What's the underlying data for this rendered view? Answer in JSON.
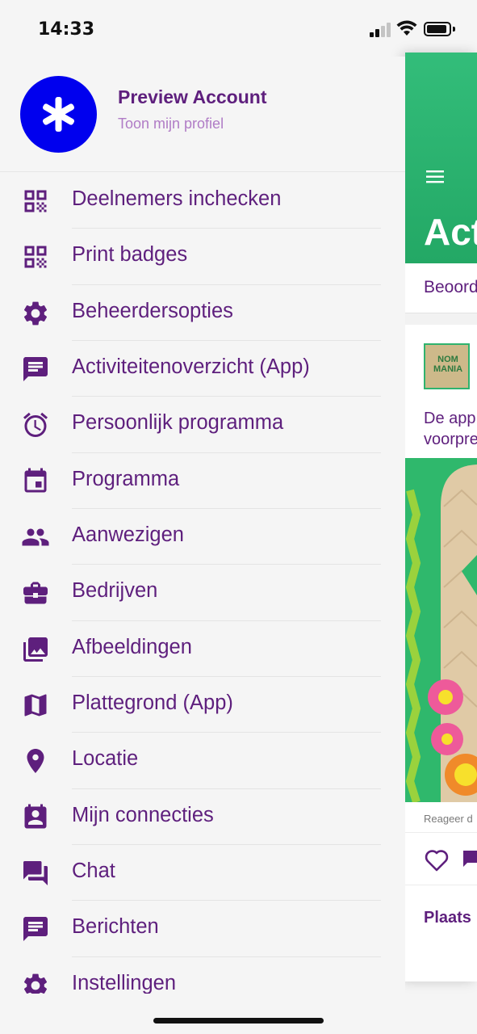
{
  "status_bar": {
    "time": "14:33"
  },
  "profile": {
    "name": "Preview Account",
    "link": "Toon mijn profiel",
    "avatar_color": "#0000ee"
  },
  "menu": {
    "items": [
      {
        "label": "Deelnemers inchecken",
        "icon": "qr-code-icon"
      },
      {
        "label": "Print badges",
        "icon": "qr-code-icon"
      },
      {
        "label": "Beheerdersopties",
        "icon": "gear-icon"
      },
      {
        "label": "Activiteitenoverzicht (App)",
        "icon": "message-icon"
      },
      {
        "label": "Persoonlijk programma",
        "icon": "alarm-clock-icon"
      },
      {
        "label": "Programma",
        "icon": "calendar-icon"
      },
      {
        "label": "Aanwezigen",
        "icon": "people-icon"
      },
      {
        "label": "Bedrijven",
        "icon": "briefcase-icon"
      },
      {
        "label": "Afbeeldingen",
        "icon": "photo-library-icon"
      },
      {
        "label": "Plattegrond (App)",
        "icon": "map-icon"
      },
      {
        "label": "Locatie",
        "icon": "location-pin-icon"
      },
      {
        "label": "Mijn connecties",
        "icon": "contact-card-icon"
      },
      {
        "label": "Chat",
        "icon": "chat-bubbles-icon"
      },
      {
        "label": "Berichten",
        "icon": "message-icon"
      },
      {
        "label": "Instellingen",
        "icon": "gear-icon"
      }
    ]
  },
  "app_screen": {
    "title": "Act",
    "tab_label": "Beoord",
    "post_logo_text": "NOM MANIA",
    "post_text_line1": "De app",
    "post_text_line2": "voorpre",
    "post_footer": "Reageer d",
    "place_label": "Plaats",
    "header_color": "#2db672"
  },
  "colors": {
    "accent": "#5e1f7d",
    "secondary_text": "#b07cc6",
    "background": "#f5f5f5"
  }
}
